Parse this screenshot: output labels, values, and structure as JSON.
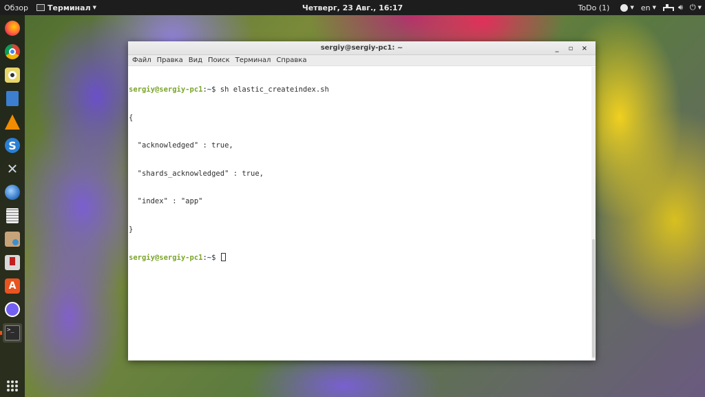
{
  "topbar": {
    "activities": "Обзор",
    "app_name": "Терминал",
    "clock": "Четверг, 23 Авг., 16:17",
    "todo": "ToDo (1)",
    "lang": "en"
  },
  "dock": {
    "items": [
      {
        "name": "firefox-icon"
      },
      {
        "name": "chrome-icon"
      },
      {
        "name": "rhythmbox-icon"
      },
      {
        "name": "libreoffice-writer-icon"
      },
      {
        "name": "vlc-icon"
      },
      {
        "name": "simplenote-icon"
      },
      {
        "name": "tools-icon"
      },
      {
        "name": "thunderbird-icon"
      },
      {
        "name": "calculator-icon"
      },
      {
        "name": "files-icon"
      },
      {
        "name": "installer-icon"
      },
      {
        "name": "software-center-icon"
      },
      {
        "name": "viber-icon"
      },
      {
        "name": "terminal-icon"
      }
    ]
  },
  "window": {
    "title": "sergiy@sergiy-pc1: ~",
    "controls": {
      "minimize": "_",
      "maximize": "▫",
      "close": "×"
    },
    "menu": [
      "Файл",
      "Правка",
      "Вид",
      "Поиск",
      "Терминал",
      "Справка"
    ]
  },
  "terminal": {
    "prompt_user": "sergiy@sergiy-pc1",
    "prompt_sep": ":",
    "prompt_path": "~",
    "prompt_symbol": "$ ",
    "command": "sh elastic_createindex.sh",
    "output": [
      "{",
      "  \"acknowledged\" : true,",
      "  \"shards_acknowledged\" : true,",
      "  \"index\" : \"app\"",
      "}"
    ]
  }
}
